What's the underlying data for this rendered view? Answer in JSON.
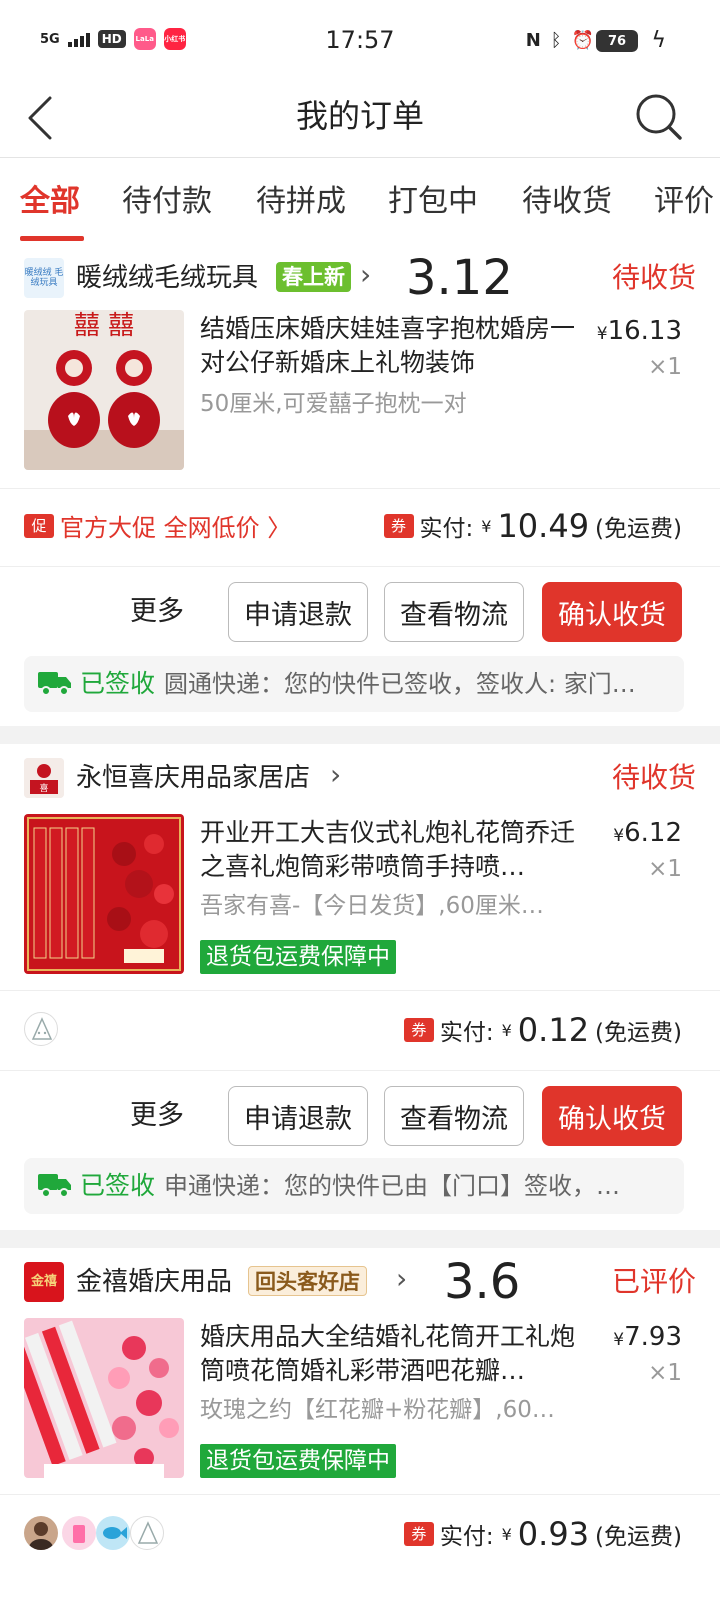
{
  "status_bar": {
    "network": "5G",
    "hd": "HD",
    "app1": "LaLa",
    "app2": "小红书",
    "time": "17:57",
    "battery": "76"
  },
  "header": {
    "title": "我的订单"
  },
  "tabs": [
    "全部",
    "待付款",
    "待拼成",
    "打包中",
    "待收货",
    "评价"
  ],
  "orders": [
    {
      "shop_name": "暖绒绒毛绒玩具",
      "shop_logo_text": "暖绒绒 毛绒玩具",
      "shop_tag": "春上新",
      "overlay_number": "3.12",
      "status": "待收货",
      "title": "结婚压床婚庆娃娃喜字抱枕婚房一对公仔新婚床上礼物装饰",
      "spec": "50厘米,可爱囍子抱枕一对",
      "price_symbol": "¥",
      "price": "16.13",
      "qty": "×1",
      "promo_badge": "促",
      "promo_text": "官方大促 全网低价 〉",
      "coupon_badge": "券",
      "pay_label": "实付:",
      "pay_amount": "10.49",
      "pay_note": "(免运费)",
      "more": "更多",
      "btn_refund": "申请退款",
      "btn_logistics": "查看物流",
      "btn_confirm": "确认收货",
      "log_status": "已签收",
      "log_text": "圆通快递：您的快件已签收，签收人: 家门…"
    },
    {
      "shop_name": "永恒喜庆用品家居店",
      "status": "待收货",
      "title": "开业开工大吉仪式礼炮礼花筒乔迁之喜礼炮筒彩带喷筒手持喷…",
      "spec": "吾家有喜-【今日发货】,60厘米…",
      "green_tag": "退货包运费保障中",
      "price_symbol": "¥",
      "price": "6.12",
      "qty": "×1",
      "coupon_badge": "券",
      "pay_label": "实付:",
      "pay_amount": "0.12",
      "pay_note": "(免运费)",
      "more": "更多",
      "btn_refund": "申请退款",
      "btn_logistics": "查看物流",
      "btn_confirm": "确认收货",
      "log_status": "已签收",
      "log_text": "申通快递：您的快件已由【门口】签收，…"
    },
    {
      "shop_name": "金禧婚庆用品",
      "shop_logo_text": "金禧",
      "shop_tag": "回头客好店",
      "overlay_number": "3.6",
      "status": "已评价",
      "title": "婚庆用品大全结婚礼花筒开工礼炮筒喷花筒婚礼彩带酒吧花瓣…",
      "spec": "玫瑰之约【红花瓣+粉花瓣】,60…",
      "green_tag": "退货包运费保障中",
      "price_symbol": "¥",
      "price": "7.93",
      "qty": "×1",
      "coupon_badge": "券",
      "pay_label": "实付:",
      "pay_amount": "0.93",
      "pay_note": "(免运费)"
    }
  ],
  "colors": {
    "accent": "#e0352b",
    "green": "#20a83b"
  }
}
